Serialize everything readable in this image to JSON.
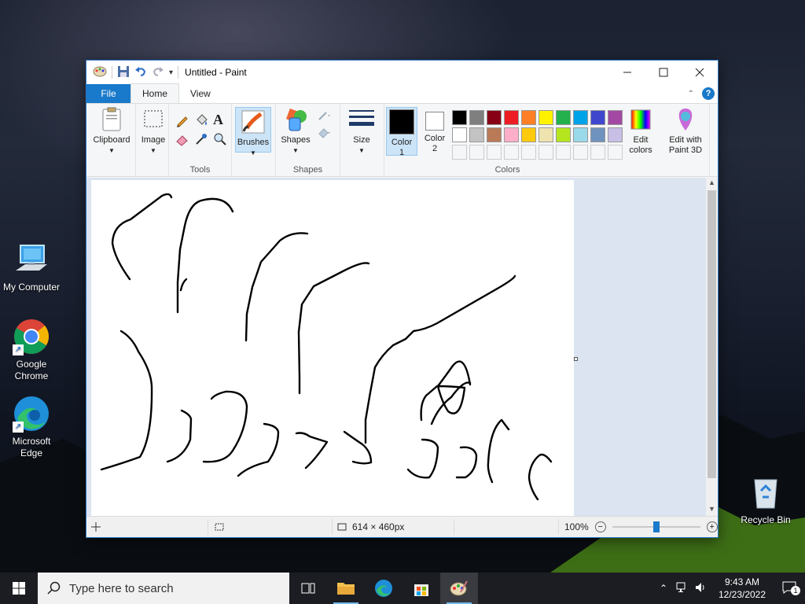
{
  "desktop": {
    "icons": [
      {
        "label": "My Computer"
      },
      {
        "label": "Google Chrome"
      },
      {
        "label": "Microsoft Edge"
      },
      {
        "label": "Recycle Bin"
      }
    ]
  },
  "window": {
    "title": "Untitled - Paint",
    "minimize_label": "—",
    "maximize_label": "☐",
    "close_label": "✕"
  },
  "tabs": {
    "file": "File",
    "home": "Home",
    "view": "View"
  },
  "ribbon": {
    "clipboard": "Clipboard",
    "image": "Image",
    "tools_group": "Tools",
    "brushes": "Brushes",
    "shapes": "Shapes",
    "shapes_group": "Shapes",
    "size": "Size",
    "color1_line1": "Color",
    "color1_line2": "1",
    "color2_line1": "Color",
    "color2_line2": "2",
    "colors_group": "Colors",
    "edit_colors_line1": "Edit",
    "edit_colors_line2": "colors",
    "edit3d_line1": "Edit with",
    "edit3d_line2": "Paint 3D",
    "palette_row1": [
      "#000000",
      "#7f7f7f",
      "#880015",
      "#ed1c24",
      "#ff7f27",
      "#fff200",
      "#22b14c",
      "#00a2e8",
      "#3f48cc",
      "#a349a4"
    ],
    "palette_row2": [
      "#ffffff",
      "#c3c3c3",
      "#b97a57",
      "#ffaec9",
      "#ffc90e",
      "#efe4b0",
      "#b5e61d",
      "#99d9ea",
      "#7092be",
      "#c8bfe7"
    ],
    "color1": "#000000",
    "color2": "#ffffff"
  },
  "status": {
    "canvas_size": "614 × 460px",
    "zoom": "100%",
    "zoom_fraction": 0.5
  },
  "taskbar": {
    "search_placeholder": "Type here to search",
    "time": "9:43 AM",
    "date": "12/23/2022",
    "notification_count": "1"
  }
}
